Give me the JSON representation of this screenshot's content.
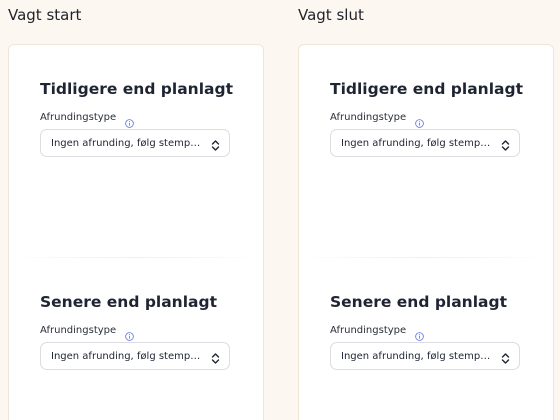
{
  "columns": [
    {
      "title": "Vagt start",
      "sections": [
        {
          "heading": "Tidligere end planlagt",
          "field_label": "Afrundingstype",
          "info_icon": "info-icon",
          "select_value": "Ingen afrunding, følg stempeltid",
          "select_icon": "chevron-up-down-icon"
        },
        {
          "heading": "Senere end planlagt",
          "field_label": "Afrundingstype",
          "info_icon": "info-icon",
          "select_value": "Ingen afrunding, følg stempeltid",
          "select_icon": "chevron-up-down-icon"
        }
      ]
    },
    {
      "title": "Vagt slut",
      "sections": [
        {
          "heading": "Tidligere end planlagt",
          "field_label": "Afrundingstype",
          "info_icon": "info-icon",
          "select_value": "Ingen afrunding, følg stempeltid",
          "select_icon": "chevron-up-down-icon"
        },
        {
          "heading": "Senere end planlagt",
          "field_label": "Afrundingstype",
          "info_icon": "info-icon",
          "select_value": "Ingen afrunding, følg stempeltid",
          "select_icon": "chevron-up-down-icon"
        }
      ]
    }
  ],
  "colors": {
    "page_background": "#fdf7f2",
    "card_background": "#ffffff",
    "info_icon": "#5b6ee1",
    "text": "#1f2433"
  }
}
